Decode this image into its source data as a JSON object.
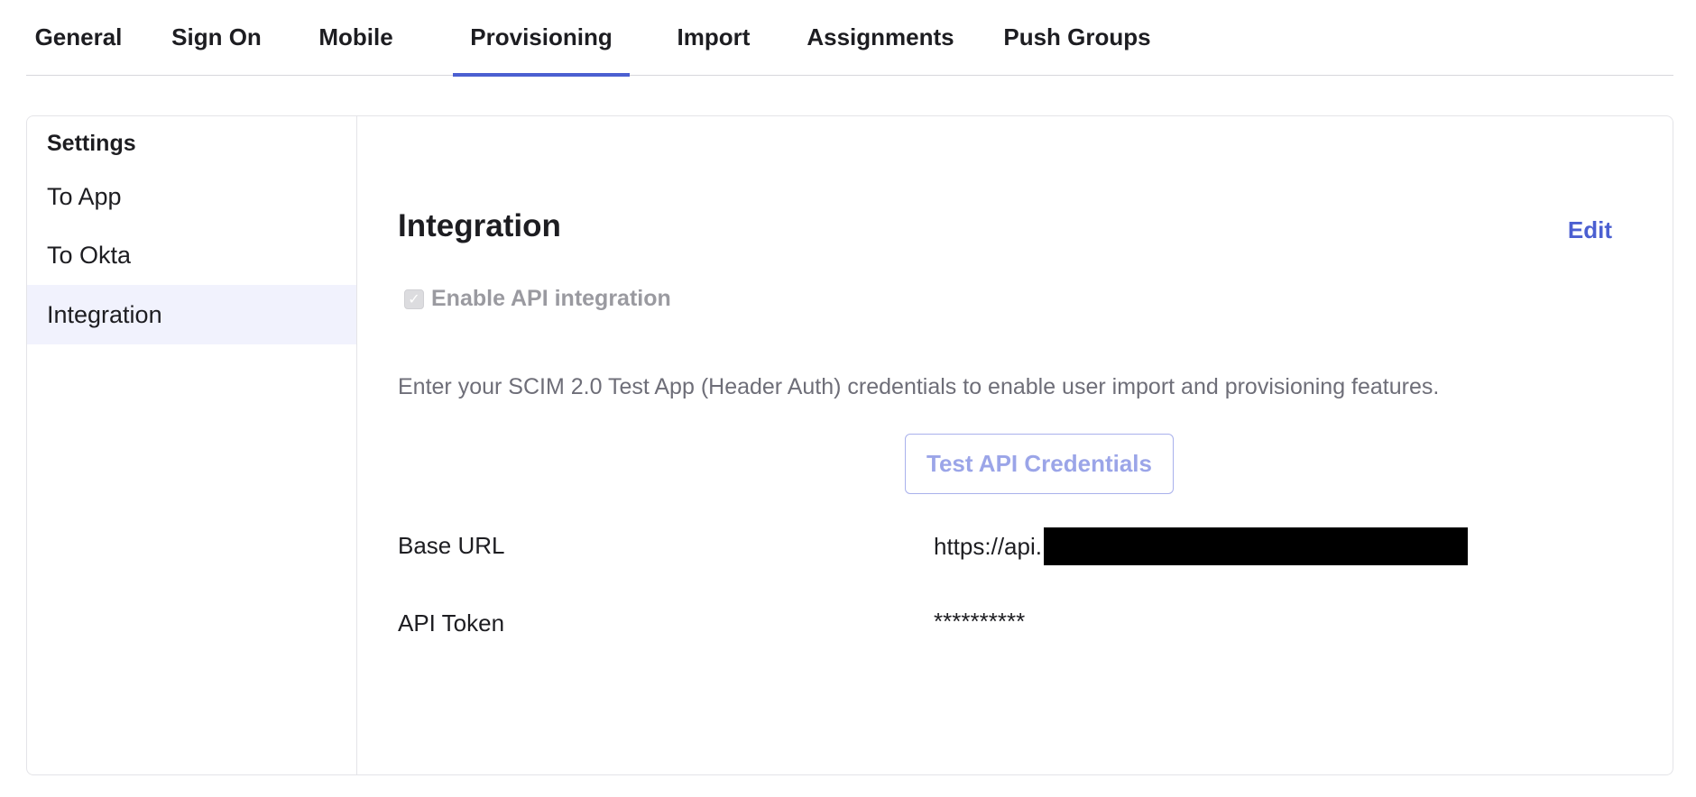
{
  "tabs": [
    {
      "label": "General",
      "active": false
    },
    {
      "label": "Sign On",
      "active": false
    },
    {
      "label": "Mobile",
      "active": false
    },
    {
      "label": "Provisioning",
      "active": true
    },
    {
      "label": "Import",
      "active": false
    },
    {
      "label": "Assignments",
      "active": false
    },
    {
      "label": "Push Groups",
      "active": false
    }
  ],
  "sidebar": {
    "heading": "Settings",
    "items": [
      {
        "label": "To App",
        "active": false
      },
      {
        "label": "To Okta",
        "active": false
      },
      {
        "label": "Integration",
        "active": true
      }
    ]
  },
  "integration": {
    "title": "Integration",
    "edit_label": "Edit",
    "enable_api": {
      "label": "Enable API integration",
      "checked": true,
      "disabled": true,
      "icon": "checkmark-icon"
    },
    "description": "Enter your SCIM 2.0 Test App (Header Auth) credentials to enable user import and provisioning features.",
    "test_button_label": "Test API Credentials",
    "fields": [
      {
        "label": "Base URL",
        "value": "https://api."
      },
      {
        "label": "API Token",
        "value": "**********"
      }
    ]
  },
  "colors": {
    "accent": "#4b5fd1",
    "active_bg": "#f1f2fd",
    "muted_text": "#6e6e78"
  }
}
